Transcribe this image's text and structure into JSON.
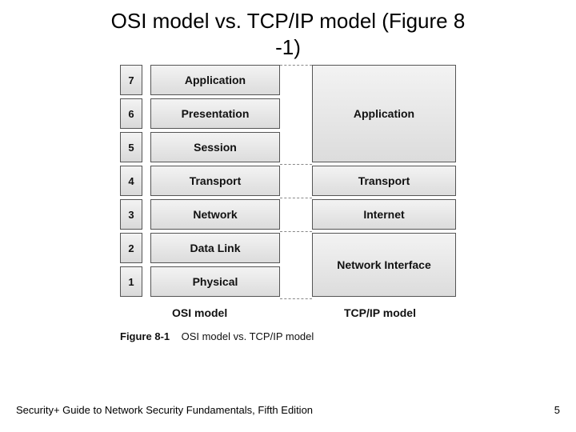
{
  "title_line1": "OSI model vs. TCP/IP model (Figure 8",
  "title_line2": "-1)",
  "osi": {
    "layers": [
      {
        "num": "7",
        "name": "Application"
      },
      {
        "num": "6",
        "name": "Presentation"
      },
      {
        "num": "5",
        "name": "Session"
      },
      {
        "num": "4",
        "name": "Transport"
      },
      {
        "num": "3",
        "name": "Network"
      },
      {
        "num": "2",
        "name": "Data Link"
      },
      {
        "num": "1",
        "name": "Physical"
      }
    ],
    "label": "OSI model"
  },
  "tcpip": {
    "layers": [
      {
        "name": "Application"
      },
      {
        "name": "Transport"
      },
      {
        "name": "Internet"
      },
      {
        "name": "Network Interface"
      }
    ],
    "label": "TCP/IP model"
  },
  "caption": {
    "figure": "Figure 8-1",
    "text": "OSI model vs. TCP/IP model"
  },
  "footer": {
    "book": "Security+ Guide to Network Security Fundamentals, Fifth Edition",
    "page": "5"
  }
}
